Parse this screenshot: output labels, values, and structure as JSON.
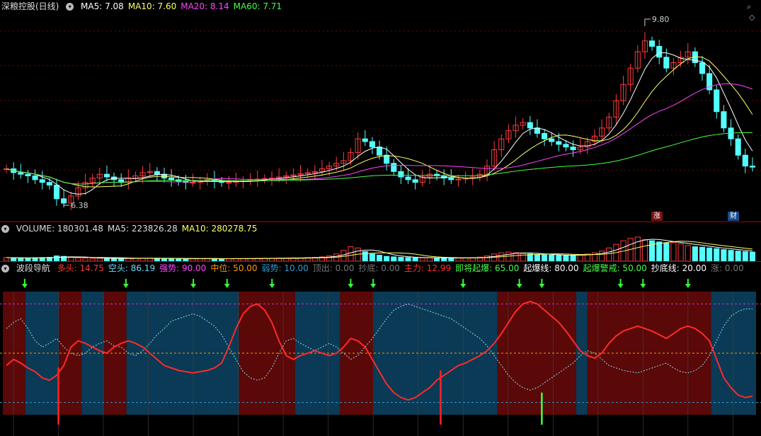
{
  "price_panel": {
    "title": "深粮控股(日线)",
    "ma": [
      {
        "label": "MA5: 7.08",
        "color": "#ffffff"
      },
      {
        "label": "MA10: 7.60",
        "color": "#ffff66"
      },
      {
        "label": "MA20: 8.14",
        "color": "#ff44ff"
      },
      {
        "label": "MA60: 7.71",
        "color": "#44ff44"
      }
    ],
    "high_label": "9.80",
    "low_label": "6.38",
    "badge_zhang": "涨",
    "badge_cai": "财",
    "corner_search": "⌕",
    "corner_expand": "◇"
  },
  "volume_panel": {
    "items": [
      {
        "label": "VOLUME: 180301.48",
        "color": "#dddddd"
      },
      {
        "label": "MA5: 223826.28",
        "color": "#dddddd"
      },
      {
        "label": "MA10: 280278.75",
        "color": "#ffff66"
      }
    ]
  },
  "indicator_panel": {
    "title": "波段导航",
    "items": [
      {
        "label": "多头: 14.75",
        "color": "#ff3333"
      },
      {
        "label": "空头: 86.19",
        "color": "#66ddff"
      },
      {
        "label": "强势: 90.00",
        "color": "#ff44ff"
      },
      {
        "label": "中位: 50.00",
        "color": "#ff9900"
      },
      {
        "label": "弱势: 10.00",
        "color": "#3399cc"
      },
      {
        "label": "顶出: 0.00",
        "color": "#777777"
      },
      {
        "label": "抄底: 0.00",
        "color": "#777777"
      },
      {
        "label": "主力: 12.99",
        "color": "#ff3333"
      },
      {
        "label": "即将起爆: 65.00",
        "color": "#44ff44"
      },
      {
        "label": "起爆线: 80.00",
        "color": "#ffffff"
      },
      {
        "label": "起爆警戒: 50.00",
        "color": "#44ff44"
      },
      {
        "label": "抄底线: 20.00",
        "color": "#ffffff"
      },
      {
        "label": "涨: 0.00",
        "color": "#777777"
      }
    ]
  },
  "colors": {
    "up": "#ff3b3b",
    "down": "#54ffff",
    "grid": "#6a0a0a",
    "ind_bg_up": "#5a0808",
    "ind_bg_down": "#0a3a55"
  },
  "chart_data": {
    "type": "candlestick",
    "price_range": [
      6.38,
      9.8
    ],
    "close": [
      7.05,
      6.98,
      6.95,
      6.92,
      6.85,
      6.8,
      6.75,
      6.5,
      6.42,
      6.55,
      6.7,
      6.8,
      6.88,
      6.95,
      6.9,
      6.85,
      6.8,
      6.88,
      6.92,
      6.98,
      7.0,
      6.95,
      6.88,
      6.85,
      6.82,
      6.8,
      6.8,
      6.82,
      6.85,
      6.82,
      6.8,
      6.8,
      6.82,
      6.83,
      6.85,
      6.86,
      6.87,
      6.88,
      6.9,
      6.92,
      6.94,
      6.96,
      6.98,
      7.0,
      7.05,
      7.1,
      7.15,
      7.2,
      7.35,
      7.6,
      7.55,
      7.45,
      7.3,
      7.15,
      7.0,
      6.9,
      6.85,
      6.8,
      6.9,
      6.95,
      6.92,
      6.88,
      6.85,
      6.86,
      6.88,
      6.9,
      6.95,
      7.1,
      7.4,
      7.6,
      7.75,
      7.85,
      7.9,
      7.8,
      7.7,
      7.6,
      7.55,
      7.5,
      7.45,
      7.4,
      7.45,
      7.55,
      7.65,
      7.8,
      8.0,
      8.3,
      8.6,
      8.9,
      9.2,
      9.4,
      9.3,
      9.1,
      8.9,
      9.0,
      9.1,
      9.2,
      9.0,
      8.8,
      8.5,
      8.1,
      7.8,
      7.6,
      7.3,
      7.1,
      7.08
    ],
    "volume_max": 280278.75,
    "volume": [
      0.15,
      0.14,
      0.13,
      0.13,
      0.14,
      0.15,
      0.16,
      0.22,
      0.2,
      0.17,
      0.14,
      0.13,
      0.12,
      0.12,
      0.11,
      0.11,
      0.11,
      0.12,
      0.12,
      0.13,
      0.13,
      0.12,
      0.11,
      0.11,
      0.1,
      0.1,
      0.1,
      0.1,
      0.11,
      0.11,
      0.1,
      0.1,
      0.11,
      0.11,
      0.11,
      0.12,
      0.12,
      0.12,
      0.13,
      0.13,
      0.14,
      0.14,
      0.15,
      0.16,
      0.18,
      0.22,
      0.3,
      0.45,
      0.6,
      0.55,
      0.4,
      0.3,
      0.25,
      0.2,
      0.18,
      0.16,
      0.15,
      0.14,
      0.14,
      0.14,
      0.13,
      0.13,
      0.13,
      0.13,
      0.14,
      0.15,
      0.17,
      0.22,
      0.3,
      0.35,
      0.38,
      0.36,
      0.32,
      0.3,
      0.28,
      0.26,
      0.25,
      0.24,
      0.24,
      0.25,
      0.27,
      0.3,
      0.35,
      0.42,
      0.55,
      0.7,
      0.85,
      0.95,
      1.0,
      0.9,
      0.85,
      0.8,
      0.75,
      0.78,
      0.72,
      0.65,
      0.6,
      0.58,
      0.55,
      0.52,
      0.48,
      0.45,
      0.42,
      0.4,
      0.38
    ],
    "indicator": {
      "range": [
        0,
        100
      ],
      "bull": [
        40,
        45,
        42,
        38,
        35,
        30,
        28,
        32,
        40,
        55,
        60,
        58,
        55,
        52,
        50,
        55,
        58,
        60,
        58,
        55,
        50,
        45,
        40,
        38,
        36,
        35,
        34,
        35,
        36,
        38,
        42,
        55,
        70,
        82,
        88,
        90,
        85,
        75,
        60,
        48,
        45,
        48,
        50,
        52,
        50,
        48,
        50,
        55,
        62,
        60,
        55,
        45,
        35,
        25,
        18,
        14,
        12,
        14,
        18,
        22,
        28,
        32,
        36,
        40,
        42,
        45,
        48,
        52,
        58,
        66,
        75,
        84,
        90,
        92,
        90,
        85,
        80,
        75,
        68,
        60,
        52,
        48,
        46,
        50,
        58,
        64,
        68,
        70,
        72,
        70,
        68,
        65,
        62,
        66,
        70,
        72,
        70,
        66,
        60,
        45,
        30,
        22,
        16,
        14,
        15
      ],
      "bear": [
        70,
        75,
        78,
        70,
        60,
        55,
        58,
        62,
        55,
        50,
        48,
        50,
        55,
        58,
        60,
        56,
        55,
        50,
        48,
        52,
        58,
        65,
        70,
        76,
        78,
        80,
        82,
        80,
        76,
        72,
        65,
        55,
        45,
        35,
        30,
        28,
        30,
        38,
        50,
        60,
        62,
        58,
        55,
        52,
        55,
        58,
        55,
        50,
        45,
        48,
        55,
        62,
        70,
        78,
        85,
        88,
        90,
        88,
        86,
        84,
        82,
        80,
        78,
        74,
        70,
        66,
        62,
        56,
        48,
        40,
        32,
        26,
        22,
        20,
        22,
        26,
        30,
        34,
        38,
        42,
        48,
        52,
        50,
        45,
        40,
        38,
        36,
        35,
        34,
        36,
        38,
        40,
        42,
        38,
        35,
        34,
        36,
        40,
        48,
        60,
        72,
        80,
        84,
        86,
        86
      ],
      "bg_blocks": [
        [
          0,
          2,
          "up"
        ],
        [
          2,
          5,
          "down"
        ],
        [
          5,
          7,
          "up"
        ],
        [
          7,
          9,
          "down"
        ],
        [
          9,
          11,
          "up"
        ],
        [
          11,
          21,
          "down"
        ],
        [
          21,
          26,
          "up"
        ],
        [
          26,
          30,
          "down"
        ],
        [
          30,
          33,
          "up"
        ],
        [
          33,
          44,
          "down"
        ],
        [
          44,
          51,
          "up"
        ],
        [
          51,
          52,
          "down"
        ],
        [
          52,
          63,
          "up"
        ],
        [
          63,
          67,
          "down"
        ]
      ],
      "arrows": [
        1,
        10,
        16,
        19,
        23,
        30,
        32,
        40,
        45,
        47,
        54,
        56,
        60
      ],
      "spikes": [
        {
          "x": 4,
          "value": 85,
          "color": "#ff2222"
        },
        {
          "x": 38,
          "value": 80,
          "color": "#ff2222"
        },
        {
          "x": 47,
          "value": 40,
          "color": "#44ff44"
        }
      ]
    }
  }
}
